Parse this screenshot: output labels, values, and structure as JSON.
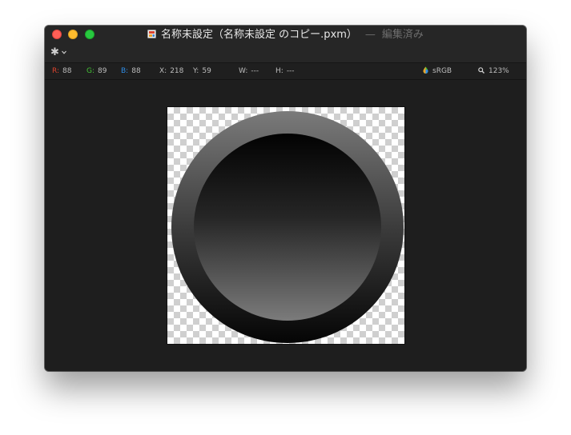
{
  "window": {
    "title": "名称未設定（名称未設定 のコピー.pxm）",
    "separator": "—",
    "status": "編集済み"
  },
  "toolbar": {
    "gear_icon": "gear-icon",
    "chevron_icon": "chevron-down-icon"
  },
  "infobar": {
    "r_label": "R:",
    "r_value": "88",
    "g_label": "G:",
    "g_value": "89",
    "b_label": "B:",
    "b_value": "88",
    "x_label": "X:",
    "x_value": "218",
    "y_label": "Y:",
    "y_value": "59",
    "w_label": "W:",
    "w_value": "---",
    "h_label": "H:",
    "h_value": "---",
    "colorspace": "sRGB",
    "zoom": "123%"
  },
  "colors": {
    "close": "#fe5f57",
    "minimize": "#febc2e",
    "zoom": "#28c840",
    "red_label": "#e0442e",
    "green_label": "#44c236",
    "blue_label": "#2f8ee8",
    "background": "#1e1e1e"
  }
}
